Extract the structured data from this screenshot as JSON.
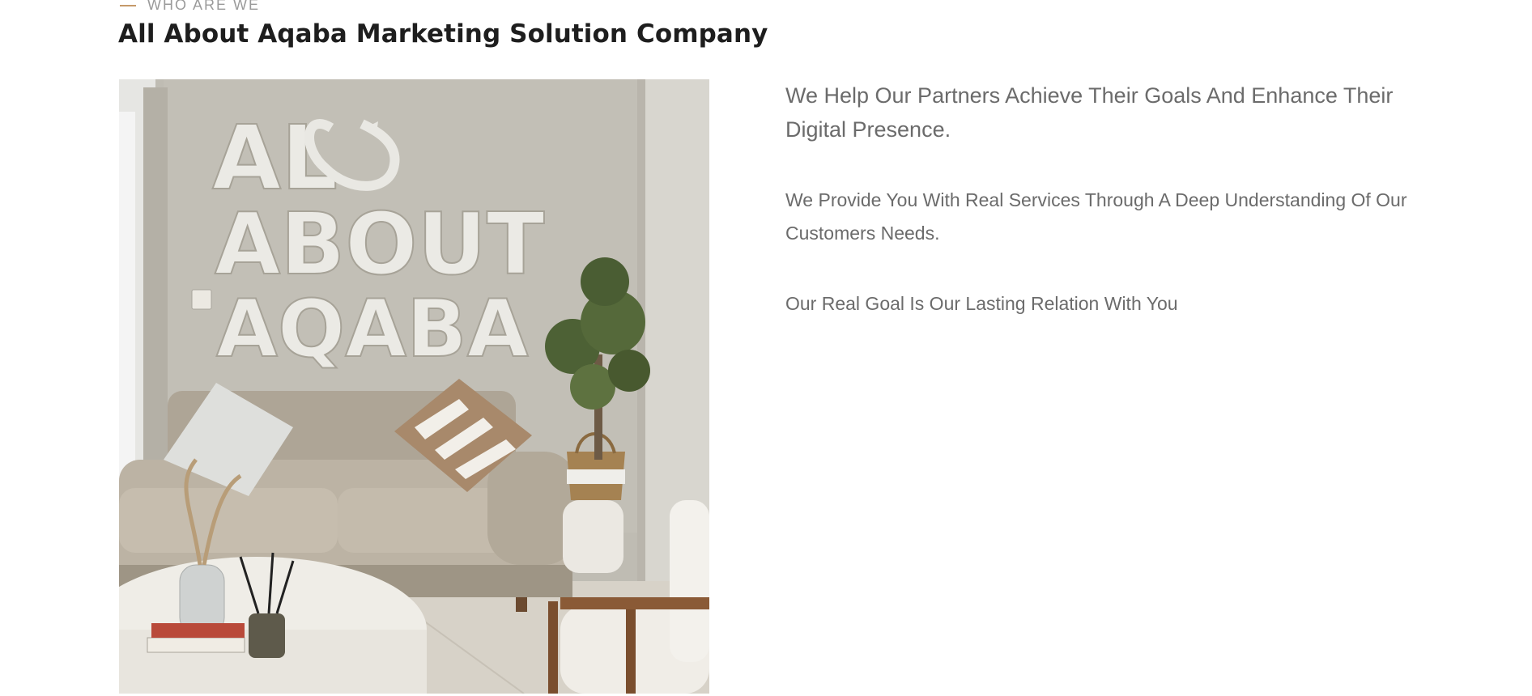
{
  "section": {
    "eyebrow": "WHO ARE WE",
    "heading": "All About Aqaba Marketing Solution Company"
  },
  "photo": {
    "wall_sign_lines": [
      "AL",
      "ABOUT",
      "AQABA"
    ]
  },
  "content": {
    "lead": "We Help Our Partners Achieve Their Goals And Enhance Their Digital Presence.",
    "paragraph_1": "We Provide You With Real Services Through A Deep Understanding Of Our Customers Needs.",
    "paragraph_2": "Our Real Goal Is Our Lasting Relation With You"
  },
  "colors": {
    "heading": "#1e1e1e",
    "body_text": "#6b6b6b",
    "eyebrow_text": "#9a9a9a",
    "eyebrow_accent": "#c59a6a",
    "background": "#ffffff"
  }
}
